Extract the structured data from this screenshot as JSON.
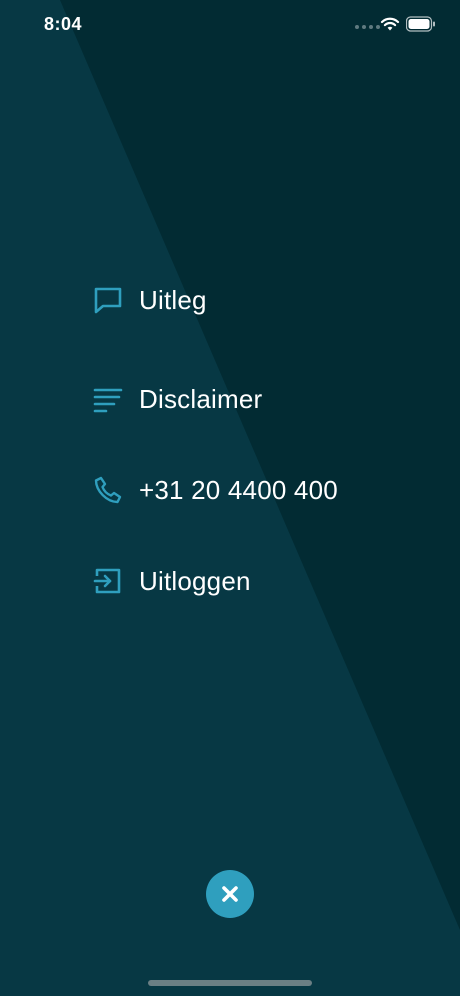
{
  "status_bar": {
    "time": "8:04",
    "wifi_icon": "wifi-icon",
    "battery_icon": "battery-icon"
  },
  "menu": {
    "items": [
      {
        "label": "Uitleg",
        "icon": "chat-bubble-icon"
      },
      {
        "label": "Disclaimer",
        "icon": "text-lines-icon"
      },
      {
        "label": "+31 20 4400 400",
        "icon": "phone-icon"
      },
      {
        "label": "Uitloggen",
        "icon": "logout-icon"
      }
    ]
  },
  "close_button": {
    "icon": "close-icon"
  },
  "colors": {
    "background_dark": "#022b33",
    "background_light": "#073844",
    "accent": "#2f9fbe",
    "text": "#ffffff"
  }
}
